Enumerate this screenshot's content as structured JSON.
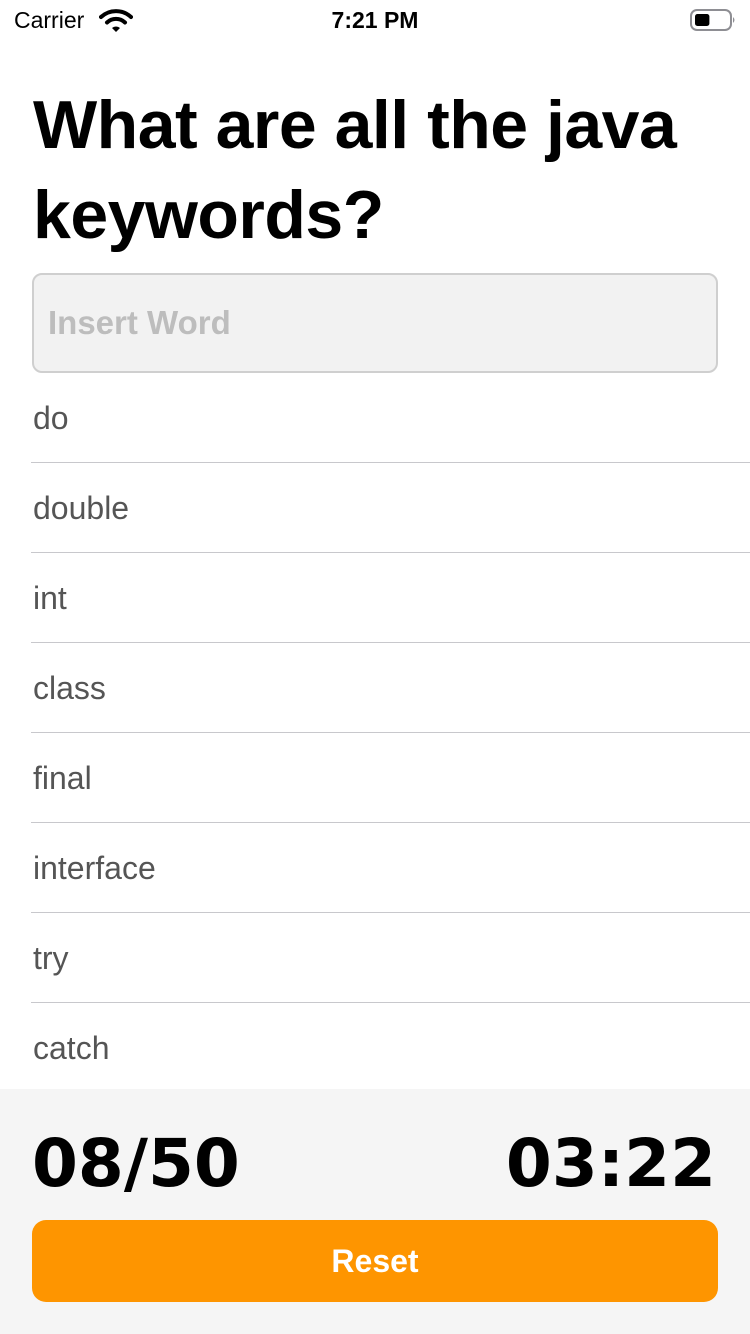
{
  "status_bar": {
    "carrier": "Carrier",
    "time": "7:21 PM",
    "battery_level": 0.45
  },
  "question": {
    "title": "What are all the java keywords?"
  },
  "input": {
    "placeholder": "Insert Word",
    "value": ""
  },
  "words": [
    "do",
    "double",
    "int",
    "class",
    "final",
    "interface",
    "try",
    "catch"
  ],
  "footer": {
    "score": "08/50",
    "timer": "03:22",
    "reset_label": "Reset"
  },
  "colors": {
    "accent": "#fe9500",
    "list_text": "#555555",
    "footer_background": "#f5f5f5"
  },
  "icons": [
    "wifi-icon",
    "battery-icon"
  ]
}
